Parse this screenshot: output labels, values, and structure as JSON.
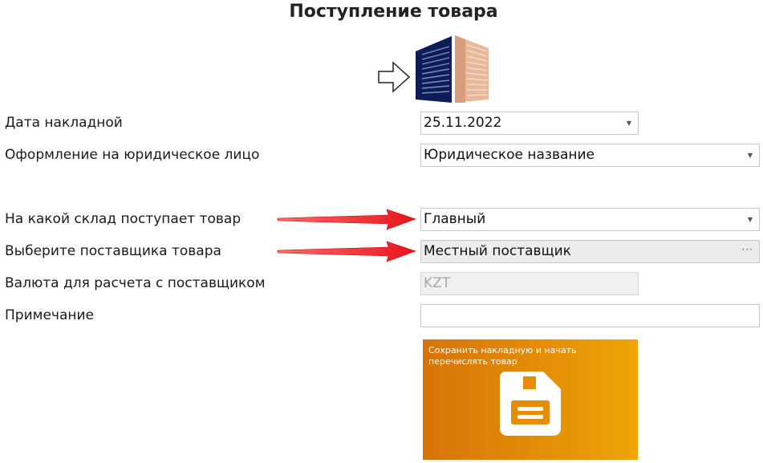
{
  "header": {
    "title": "Поступление товара"
  },
  "form": {
    "invoice_date": {
      "label": "Дата накладной",
      "value": "25.11.2022"
    },
    "legal_entity": {
      "label": "Оформление на юридическое лицо",
      "value": "Юридическое название"
    },
    "warehouse": {
      "label": "На какой склад поступает товар",
      "value": "Главный"
    },
    "supplier": {
      "label": "Выберите поставщика товара",
      "value": "Местный поставщик",
      "button_text": "···"
    },
    "currency": {
      "label": "Валюта для расчета с поставщиком",
      "value": "KZT"
    },
    "note": {
      "label": "Примечание",
      "value": ""
    }
  },
  "action_tile": {
    "label": "Сохранить накладную и начать перечислять товар",
    "color_start": "#d77309",
    "color_end": "#eda506"
  },
  "annotations": {
    "arrow_color": "#e8141c"
  },
  "icons": {
    "hero": "warehouse-building-icon",
    "hero_arrow": "arrow-right-outline-icon",
    "tile": "floppy-disk-icon"
  }
}
